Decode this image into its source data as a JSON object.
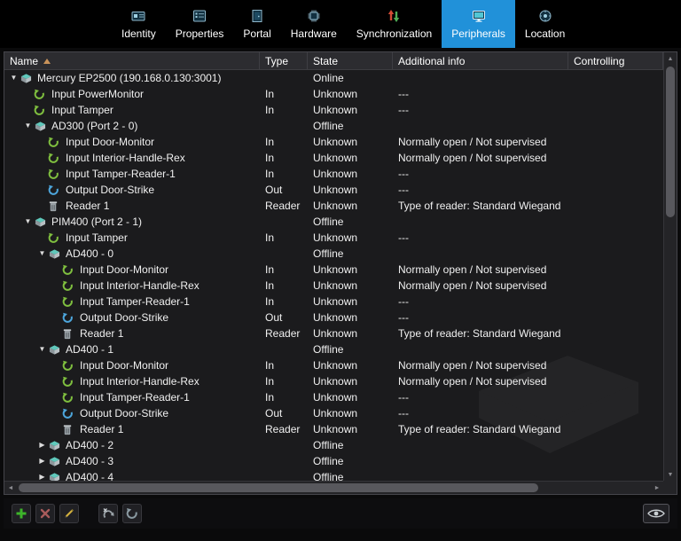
{
  "tabs": [
    {
      "label": "Identity",
      "icon": "id-card-icon",
      "selected": false
    },
    {
      "label": "Properties",
      "icon": "properties-icon",
      "selected": false
    },
    {
      "label": "Portal",
      "icon": "portal-icon",
      "selected": false
    },
    {
      "label": "Hardware",
      "icon": "hardware-icon",
      "selected": false
    },
    {
      "label": "Synchronization",
      "icon": "sync-arrows-icon",
      "selected": false
    },
    {
      "label": "Peripherals",
      "icon": "peripherals-icon",
      "selected": true
    },
    {
      "label": "Location",
      "icon": "location-icon",
      "selected": false
    }
  ],
  "table": {
    "columns": [
      "Name",
      "Type",
      "State",
      "Additional info",
      "Controlling"
    ],
    "sort_column": "Name",
    "sort_direction": "ascending"
  },
  "rows": [
    {
      "level": 0,
      "icon": "controller",
      "expand": "expanded",
      "name": "Mercury EP2500 (190.168.0.130:3001)",
      "type": "",
      "state": "Online",
      "info": "",
      "controlling": ""
    },
    {
      "level": 1,
      "icon": "input",
      "expand": "none",
      "name": "Input PowerMonitor",
      "type": "In",
      "state": "Unknown",
      "info": "---",
      "controlling": ""
    },
    {
      "level": 1,
      "icon": "input",
      "expand": "none",
      "name": "Input Tamper",
      "type": "In",
      "state": "Unknown",
      "info": "---",
      "controlling": ""
    },
    {
      "level": 1,
      "icon": "controller",
      "expand": "expanded",
      "name": "AD300 (Port 2 - 0)",
      "type": "",
      "state": "Offline",
      "info": "",
      "controlling": ""
    },
    {
      "level": 2,
      "icon": "input",
      "expand": "none",
      "name": "Input Door-Monitor",
      "type": "In",
      "state": "Unknown",
      "info": "Normally open / Not supervised",
      "controlling": ""
    },
    {
      "level": 2,
      "icon": "input",
      "expand": "none",
      "name": "Input Interior-Handle-Rex",
      "type": "In",
      "state": "Unknown",
      "info": "Normally open / Not supervised",
      "controlling": ""
    },
    {
      "level": 2,
      "icon": "input",
      "expand": "none",
      "name": "Input Tamper-Reader-1",
      "type": "In",
      "state": "Unknown",
      "info": "---",
      "controlling": ""
    },
    {
      "level": 2,
      "icon": "output",
      "expand": "none",
      "name": "Output Door-Strike",
      "type": "Out",
      "state": "Unknown",
      "info": "---",
      "controlling": ""
    },
    {
      "level": 2,
      "icon": "reader",
      "expand": "none",
      "name": "Reader 1",
      "type": "Reader",
      "state": "Unknown",
      "info": "Type of reader: Standard Wiegand",
      "controlling": ""
    },
    {
      "level": 1,
      "icon": "controller",
      "expand": "expanded",
      "name": "PIM400 (Port 2 - 1)",
      "type": "",
      "state": "Offline",
      "info": "",
      "controlling": ""
    },
    {
      "level": 2,
      "icon": "input",
      "expand": "none",
      "name": "Input Tamper",
      "type": "In",
      "state": "Unknown",
      "info": "---",
      "controlling": ""
    },
    {
      "level": 2,
      "icon": "controller",
      "expand": "expanded",
      "name": "AD400 - 0",
      "type": "",
      "state": "Offline",
      "info": "",
      "controlling": ""
    },
    {
      "level": 3,
      "icon": "input",
      "expand": "none",
      "name": "Input Door-Monitor",
      "type": "In",
      "state": "Unknown",
      "info": "Normally open / Not supervised",
      "controlling": ""
    },
    {
      "level": 3,
      "icon": "input",
      "expand": "none",
      "name": "Input Interior-Handle-Rex",
      "type": "In",
      "state": "Unknown",
      "info": "Normally open / Not supervised",
      "controlling": ""
    },
    {
      "level": 3,
      "icon": "input",
      "expand": "none",
      "name": "Input Tamper-Reader-1",
      "type": "In",
      "state": "Unknown",
      "info": "---",
      "controlling": ""
    },
    {
      "level": 3,
      "icon": "output",
      "expand": "none",
      "name": "Output Door-Strike",
      "type": "Out",
      "state": "Unknown",
      "info": "---",
      "controlling": ""
    },
    {
      "level": 3,
      "icon": "reader",
      "expand": "none",
      "name": "Reader 1",
      "type": "Reader",
      "state": "Unknown",
      "info": "Type of reader: Standard Wiegand",
      "controlling": ""
    },
    {
      "level": 2,
      "icon": "controller",
      "expand": "expanded",
      "name": "AD400 - 1",
      "type": "",
      "state": "Offline",
      "info": "",
      "controlling": ""
    },
    {
      "level": 3,
      "icon": "input",
      "expand": "none",
      "name": "Input Door-Monitor",
      "type": "In",
      "state": "Unknown",
      "info": "Normally open / Not supervised",
      "controlling": ""
    },
    {
      "level": 3,
      "icon": "input",
      "expand": "none",
      "name": "Input Interior-Handle-Rex",
      "type": "In",
      "state": "Unknown",
      "info": "Normally open / Not supervised",
      "controlling": ""
    },
    {
      "level": 3,
      "icon": "input",
      "expand": "none",
      "name": "Input Tamper-Reader-1",
      "type": "In",
      "state": "Unknown",
      "info": "---",
      "controlling": ""
    },
    {
      "level": 3,
      "icon": "output",
      "expand": "none",
      "name": "Output Door-Strike",
      "type": "Out",
      "state": "Unknown",
      "info": "---",
      "controlling": ""
    },
    {
      "level": 3,
      "icon": "reader",
      "expand": "none",
      "name": "Reader 1",
      "type": "Reader",
      "state": "Unknown",
      "info": "Type of reader: Standard Wiegand",
      "controlling": ""
    },
    {
      "level": 2,
      "icon": "controller",
      "expand": "collapsed",
      "name": "AD400 - 2",
      "type": "",
      "state": "Offline",
      "info": "",
      "controlling": ""
    },
    {
      "level": 2,
      "icon": "controller",
      "expand": "collapsed",
      "name": "AD400 - 3",
      "type": "",
      "state": "Offline",
      "info": "",
      "controlling": ""
    },
    {
      "level": 2,
      "icon": "controller",
      "expand": "collapsed",
      "name": "AD400 - 4",
      "type": "",
      "state": "Offline",
      "info": "",
      "controlling": ""
    }
  ],
  "toolbar": {
    "buttons": [
      {
        "name": "add",
        "icon": "plus-icon"
      },
      {
        "name": "delete",
        "icon": "cross-icon"
      },
      {
        "name": "edit",
        "icon": "pencil-icon"
      },
      {
        "name": "unassign",
        "icon": "curved-arrow-cross-icon"
      },
      {
        "name": "assign",
        "icon": "curved-arrow-icon"
      },
      {
        "name": "view",
        "icon": "eye-icon"
      }
    ]
  },
  "icons": {
    "scroll_up": "▲",
    "scroll_down": "▼",
    "scroll_left": "◄",
    "scroll_right": "►"
  },
  "colors": {
    "selected_tab": "#2191d9",
    "add_green": "#3db32a",
    "delete_red": "#a85b5b",
    "edit_yellow": "#d3b13e",
    "input_green": "#7fbf3f",
    "output_blue": "#4da6dc",
    "sort_arrow": "#c9935a"
  }
}
